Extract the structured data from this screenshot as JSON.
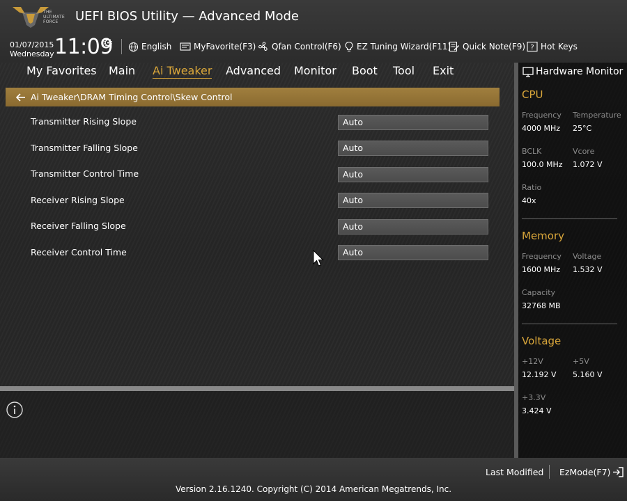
{
  "header": {
    "logo_text": "THE ULTIMATE FORCE",
    "title": "UEFI BIOS Utility — Advanced Mode",
    "date": "01/07/2015",
    "weekday": "Wednesday",
    "time": "11:09",
    "tools": [
      {
        "label": "English",
        "icon": "globe-icon"
      },
      {
        "label": "MyFavorite(F3)",
        "icon": "favorite-icon"
      },
      {
        "label": "Qfan Control(F6)",
        "icon": "fan-icon"
      },
      {
        "label": "EZ Tuning Wizard(F11)",
        "icon": "bulb-icon"
      },
      {
        "label": "Quick Note(F9)",
        "icon": "note-icon"
      },
      {
        "label": "Hot Keys",
        "icon": "help-icon"
      }
    ]
  },
  "menu": {
    "items": [
      "My Favorites",
      "Main",
      "Ai Tweaker",
      "Advanced",
      "Monitor",
      "Boot",
      "Tool",
      "Exit"
    ],
    "active": "Ai Tweaker"
  },
  "breadcrumb": "Ai Tweaker\\DRAM Timing Control\\Skew Control",
  "settings": [
    {
      "label": "Transmitter Rising Slope",
      "value": "Auto"
    },
    {
      "label": "Transmitter Falling Slope",
      "value": "Auto"
    },
    {
      "label": "Transmitter Control Time",
      "value": "Auto"
    },
    {
      "label": "Receiver Rising Slope",
      "value": "Auto"
    },
    {
      "label": "Receiver Falling Slope",
      "value": "Auto"
    },
    {
      "label": "Receiver Control Time",
      "value": "Auto"
    }
  ],
  "hardware_monitor": {
    "title": "Hardware Monitor",
    "cpu": {
      "heading": "CPU",
      "frequency_label": "Frequency",
      "frequency": "4000 MHz",
      "temperature_label": "Temperature",
      "temperature": "25°C",
      "bclk_label": "BCLK",
      "bclk": "100.0 MHz",
      "vcore_label": "Vcore",
      "vcore": "1.072 V",
      "ratio_label": "Ratio",
      "ratio": "40x"
    },
    "memory": {
      "heading": "Memory",
      "frequency_label": "Frequency",
      "frequency": "1600 MHz",
      "voltage_label": "Voltage",
      "voltage": "1.532 V",
      "capacity_label": "Capacity",
      "capacity": "32768 MB"
    },
    "voltage": {
      "heading": "Voltage",
      "v12_label": "+12V",
      "v12": "12.192 V",
      "v5_label": "+5V",
      "v5": "5.160 V",
      "v33_label": "+3.3V",
      "v33": "3.424 V"
    }
  },
  "footer": {
    "last_modified": "Last Modified",
    "ezmode": "EzMode(F7)",
    "copyright": "Version 2.16.1240. Copyright (C) 2014 American Megatrends, Inc."
  },
  "colors": {
    "accent": "#d9a63a",
    "breadcrumb_bar": "#9a783a"
  }
}
